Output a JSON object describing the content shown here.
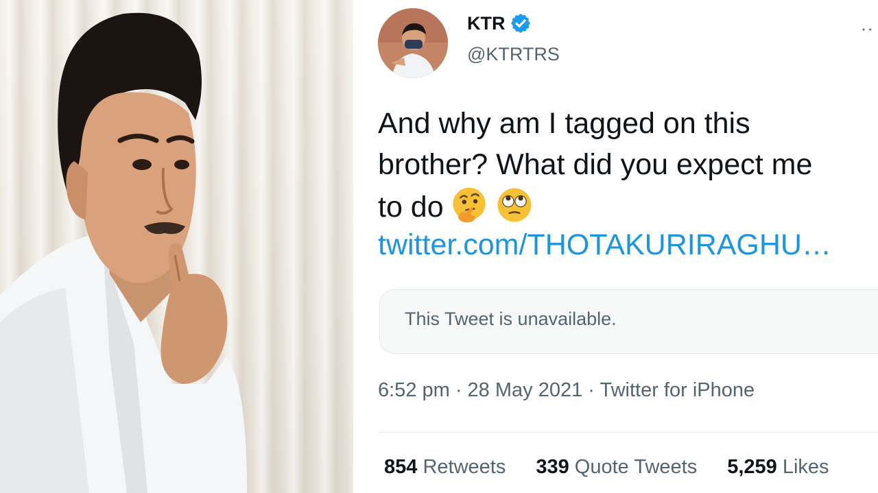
{
  "photo": {
    "subject": "man-in-white-shirt-photo"
  },
  "tweet": {
    "author": {
      "name": "KTR",
      "handle": "@KTRTRS",
      "verified": true,
      "verified_icon": "verified-badge-icon"
    },
    "text_lines": [
      "And why am I tagged on this",
      "brother? What did you expect me",
      "to do"
    ],
    "emojis": [
      "thinking-face-icon",
      "face-with-rolling-eyes-icon"
    ],
    "link": "twitter.com/THOTAKURIRAGHU…",
    "quoted": {
      "message": "This Tweet is unavailable."
    },
    "meta": "6:52 pm · 28 May 2021 · Twitter for iPhone",
    "stats": {
      "retweets": {
        "count": "854",
        "label": "Retweets"
      },
      "quote_tweets": {
        "count": "339",
        "label": "Quote Tweets"
      },
      "likes": {
        "count": "5,259",
        "label": "Likes"
      }
    }
  },
  "colors": {
    "link": "#1b95e0",
    "verified": "#1d9bf0",
    "secondary_text": "#536471",
    "primary_text": "#0f1419"
  }
}
